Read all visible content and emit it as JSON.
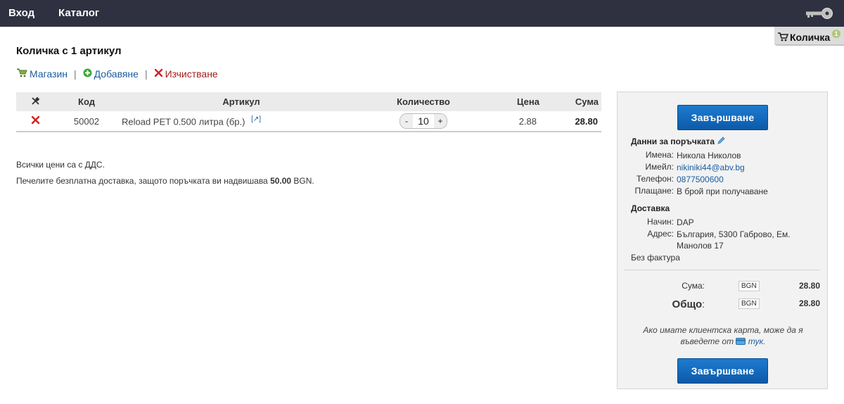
{
  "topbar": {
    "login": "Вход",
    "catalog": "Каталог"
  },
  "cart_tab": {
    "label": "Количка",
    "badge": "1"
  },
  "page_title": "Количка с 1 артикул",
  "toolbar": {
    "shop": "Магазин",
    "add": "Добавяне",
    "clear": "Изчистване",
    "separator": "|"
  },
  "table": {
    "headers": {
      "code": "Код",
      "item": "Артикул",
      "qty": "Количество",
      "price": "Цена",
      "sum": "Сума"
    },
    "rows": [
      {
        "code": "50002",
        "item": "Reload PET 0.500 литра (бр.)",
        "link": "[↗]",
        "qty_minus": "-",
        "qty": "10",
        "qty_plus": "+",
        "price": "2.88",
        "sum": "28.80"
      }
    ]
  },
  "notes": {
    "vat": "Всички цени са с ДДС.",
    "free_delivery_prefix": "Печелите безплатна доставка, защото поръчката ви надвишава ",
    "free_delivery_amount": "50.00",
    "free_delivery_currency": " BGN."
  },
  "sidebar": {
    "finish_label": "Завършване",
    "order_title": "Данни за поръчката",
    "order": {
      "name_label": "Имена:",
      "name": "Никола Николов",
      "email_label": "Имейл:",
      "email": "nikiniki44@abv.bg",
      "phone_label": "Телефон:",
      "phone": "0877500600",
      "payment_label": "Плащане:",
      "payment": "В брой при получаване"
    },
    "delivery_title": "Доставка",
    "delivery": {
      "method_label": "Начин:",
      "method": "DAP",
      "address_label": "Адрес:",
      "address": "България, 5300 Габрово, Ем. Манолов 17"
    },
    "invoice": "Без фактура",
    "totals": {
      "sum_label": "Сума:",
      "sum_currency": "BGN",
      "sum_amount": "28.80",
      "total_label": "Общо:",
      "total_word": "Общо",
      "total_colon": ":",
      "total_currency": "BGN",
      "total_amount": "28.80"
    },
    "card_note_prefix": "Ако имате клиентска карта, може да я въведете от ",
    "card_note_link": "тук."
  }
}
